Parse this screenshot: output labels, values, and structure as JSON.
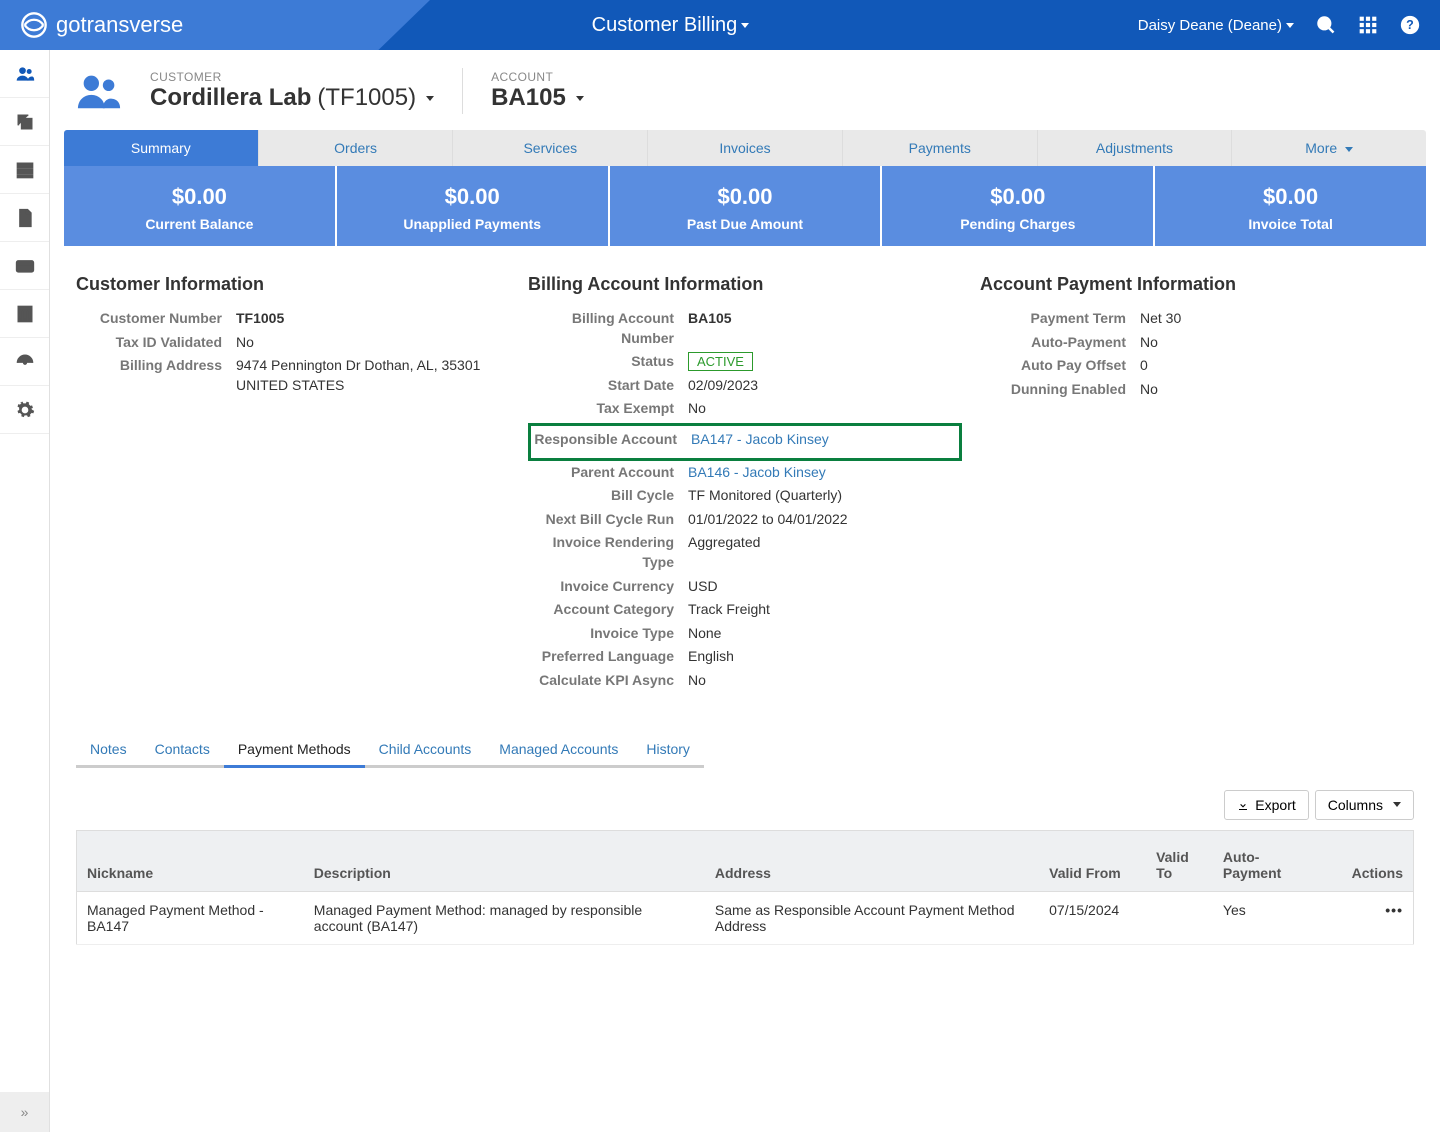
{
  "topbar": {
    "brand": "gotransverse",
    "title": "Customer Billing",
    "user": "Daisy Deane (Deane)"
  },
  "header": {
    "customer_lbl": "CUSTOMER",
    "customer_name": "Cordillera Lab",
    "customer_code": "(TF1005)",
    "account_lbl": "ACCOUNT",
    "account_name": "BA105"
  },
  "tabs": [
    "Summary",
    "Orders",
    "Services",
    "Invoices",
    "Payments",
    "Adjustments",
    "More"
  ],
  "stats": [
    {
      "val": "$0.00",
      "lbl": "Current Balance"
    },
    {
      "val": "$0.00",
      "lbl": "Unapplied Payments"
    },
    {
      "val": "$0.00",
      "lbl": "Past Due Amount"
    },
    {
      "val": "$0.00",
      "lbl": "Pending Charges"
    },
    {
      "val": "$0.00",
      "lbl": "Invoice Total"
    }
  ],
  "customer_info": {
    "title": "Customer Information",
    "rows": {
      "num_lbl": "Customer Number",
      "num": "TF1005",
      "tax_lbl": "Tax ID Validated",
      "tax": "No",
      "addr_lbl": "Billing Address",
      "addr": "9474 Pennington Dr Dothan, AL, 35301 UNITED STATES"
    }
  },
  "billing_info": {
    "title": "Billing Account Information",
    "ban_lbl": "Billing Account Number",
    "ban": "BA105",
    "status_lbl": "Status",
    "status": "ACTIVE",
    "start_lbl": "Start Date",
    "start": "02/09/2023",
    "taxex_lbl": "Tax Exempt",
    "taxex": "No",
    "resp_lbl": "Responsible Account",
    "resp": "BA147 - Jacob Kinsey",
    "parent_lbl": "Parent Account",
    "parent": "BA146 - Jacob Kinsey",
    "cycle_lbl": "Bill Cycle",
    "cycle": "TF Monitored (Quarterly)",
    "next_lbl": "Next Bill Cycle Run",
    "next": "01/01/2022 to 04/01/2022",
    "render_lbl": "Invoice Rendering Type",
    "render": "Aggregated",
    "curr_lbl": "Invoice Currency",
    "curr": "USD",
    "cat_lbl": "Account Category",
    "cat": "Track Freight",
    "itype_lbl": "Invoice Type",
    "itype": "None",
    "lang_lbl": "Preferred Language",
    "lang": "English",
    "kpi_lbl": "Calculate KPI Async",
    "kpi": "No"
  },
  "payment_info": {
    "title": "Account Payment Information",
    "term_lbl": "Payment Term",
    "term": "Net 30",
    "auto_lbl": "Auto-Payment",
    "auto": "No",
    "off_lbl": "Auto Pay Offset",
    "off": "0",
    "dun_lbl": "Dunning Enabled",
    "dun": "No"
  },
  "subtabs": [
    "Notes",
    "Contacts",
    "Payment Methods",
    "Child Accounts",
    "Managed Accounts",
    "History"
  ],
  "tbl_buttons": {
    "export": "Export",
    "columns": "Columns"
  },
  "tbl_head": {
    "nick": "Nickname",
    "desc": "Description",
    "addr": "Address",
    "from": "Valid From",
    "to": "Valid To",
    "auto": "Auto-Payment",
    "act": "Actions"
  },
  "tbl_row": {
    "nick": "Managed Payment Method - BA147",
    "desc": "Managed Payment Method: managed by responsible account (BA147)",
    "addr": "Same as Responsible Account Payment Method Address",
    "from": "07/15/2024",
    "to": "",
    "auto": "Yes"
  }
}
